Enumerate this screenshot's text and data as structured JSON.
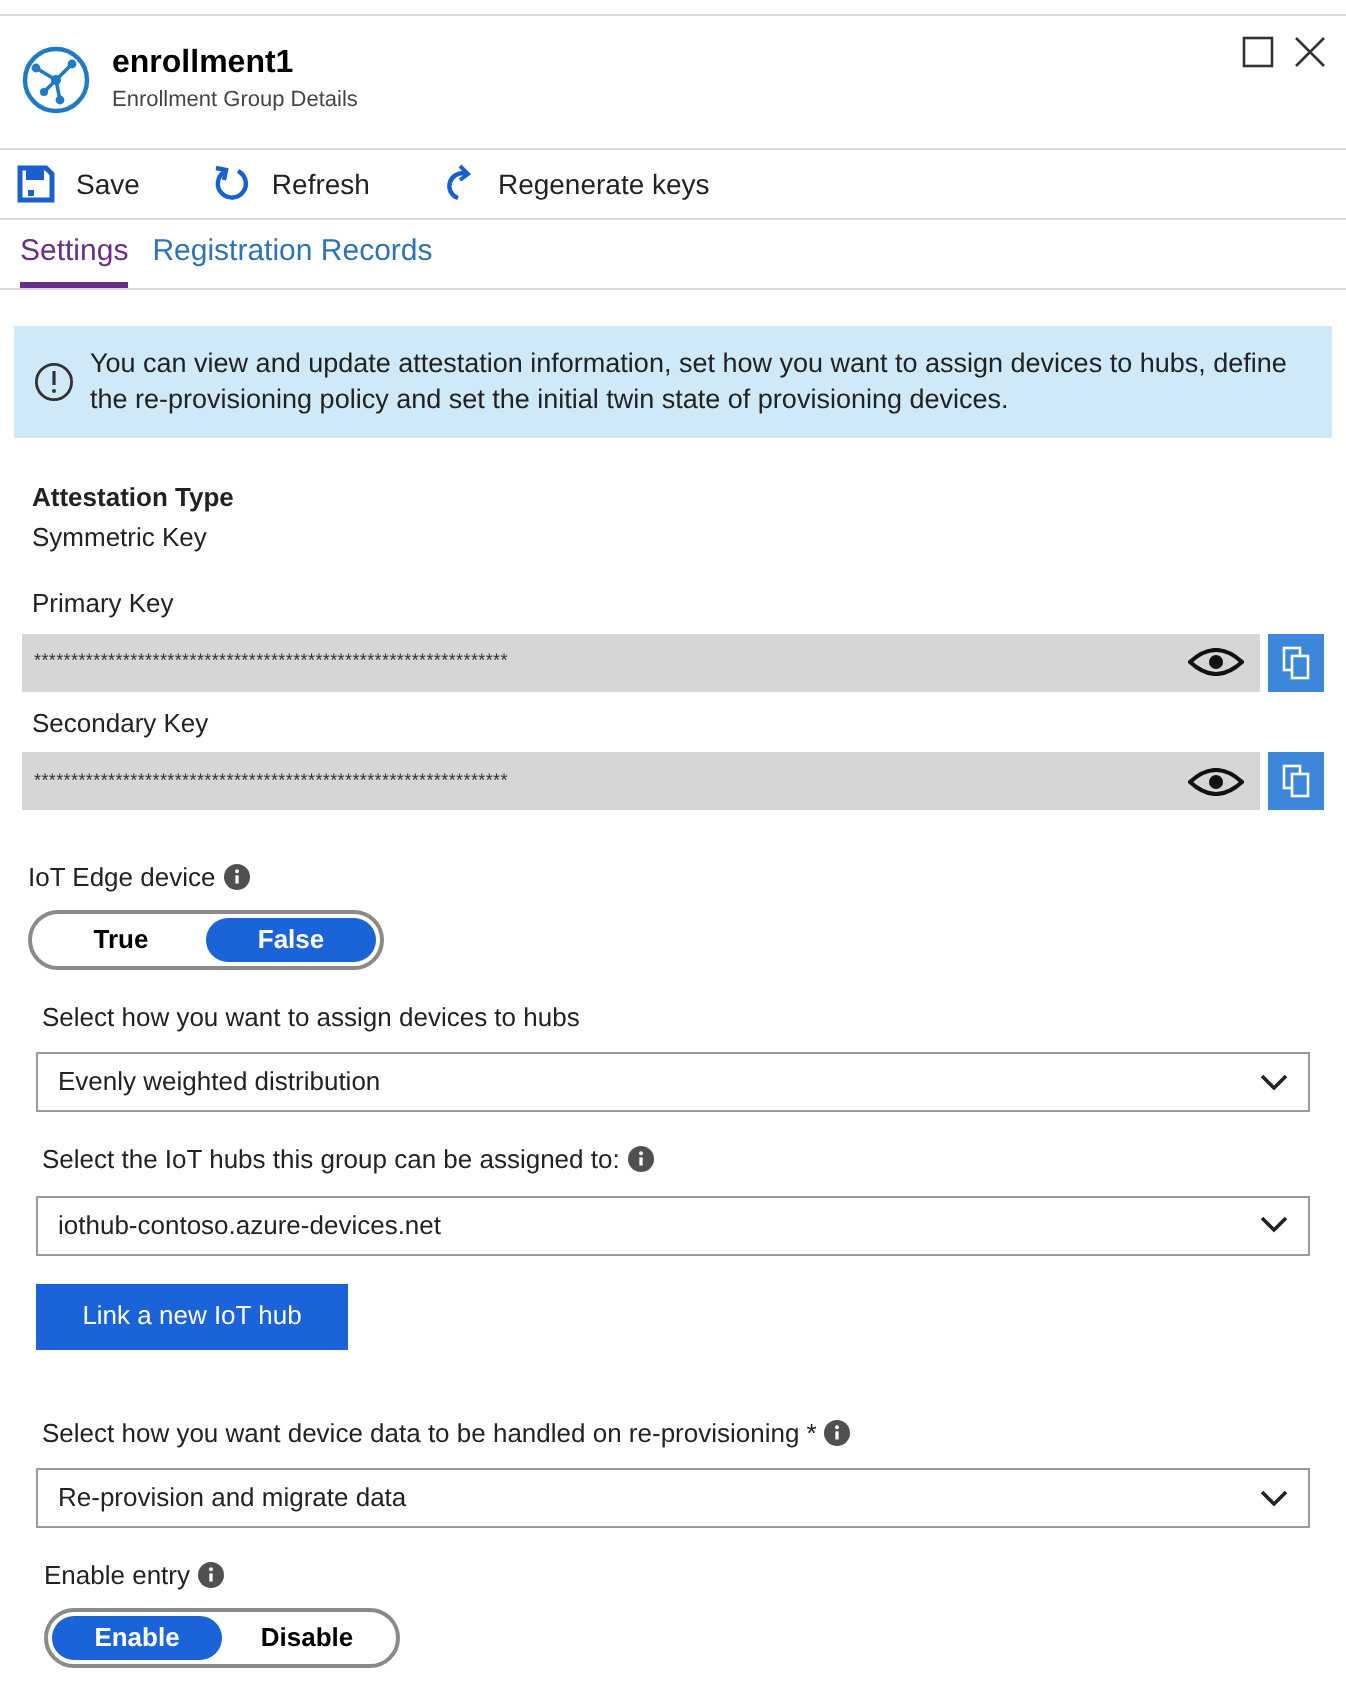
{
  "header": {
    "title": "enrollment1",
    "subtitle": "Enrollment Group Details"
  },
  "toolbar": [
    {
      "kind": "save",
      "label": "Save"
    },
    {
      "kind": "refresh",
      "label": "Refresh"
    },
    {
      "kind": "regenerate",
      "label": "Regenerate keys"
    }
  ],
  "tabs": [
    {
      "label": "Settings",
      "selected": true
    },
    {
      "label": "Registration Records",
      "selected": false
    }
  ],
  "info_banner": "You can view and update attestation information, set how you want to assign devices to hubs, define the re-provisioning policy and set the initial twin state of provisioning devices.",
  "attestation": {
    "label": "Attestation Type",
    "value": "Symmetric Key"
  },
  "keys": [
    {
      "label": "Primary Key",
      "value": "****************************************************************"
    },
    {
      "label": "Secondary Key",
      "value": "****************************************************************"
    }
  ],
  "iot_edge": {
    "label": "IoT Edge device",
    "options": [
      {
        "label": "True",
        "selected": false
      },
      {
        "label": "False",
        "selected": true
      }
    ]
  },
  "assign": {
    "label": "Select how you want to assign devices to hubs",
    "value": "Evenly weighted distribution"
  },
  "hubs": {
    "label": "Select the IoT hubs this group can be assigned to:",
    "value": "iothub-contoso.azure-devices.net",
    "button": "Link a new IoT hub"
  },
  "reprovision": {
    "label": "Select how you want device data to be handled on re-provisioning *",
    "value": "Re-provision and migrate data"
  },
  "enable_entry": {
    "label": "Enable entry",
    "options": [
      {
        "label": "Enable",
        "selected": true
      },
      {
        "label": "Disable",
        "selected": false
      }
    ]
  }
}
